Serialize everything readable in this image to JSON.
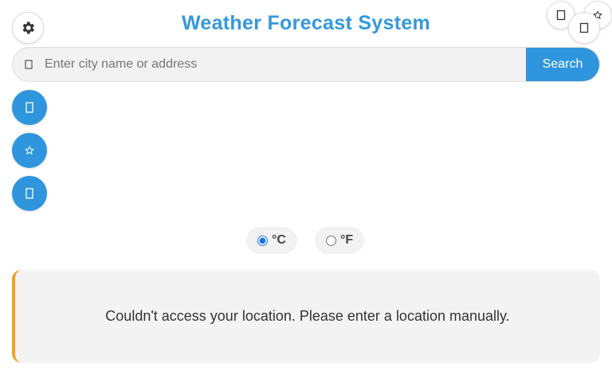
{
  "header": {
    "title": "Weather Forecast System",
    "settings_icon": "gear-icon",
    "top_right_icons": [
      "moon-icon",
      "star-icon",
      "moon-icon"
    ]
  },
  "search": {
    "placeholder": "Enter city name or address",
    "value": "",
    "button_label": "Search",
    "icon": "search-icon"
  },
  "side_actions": [
    "location-icon",
    "star-icon",
    "history-icon"
  ],
  "units": {
    "options": [
      {
        "label": "°C",
        "selected": true
      },
      {
        "label": "°F",
        "selected": false
      }
    ]
  },
  "message": {
    "text": "Couldn't access your location. Please enter a location manually."
  },
  "colors": {
    "accent": "#3498db",
    "button": "#2f96dd",
    "warning_border": "#f0a21e"
  }
}
